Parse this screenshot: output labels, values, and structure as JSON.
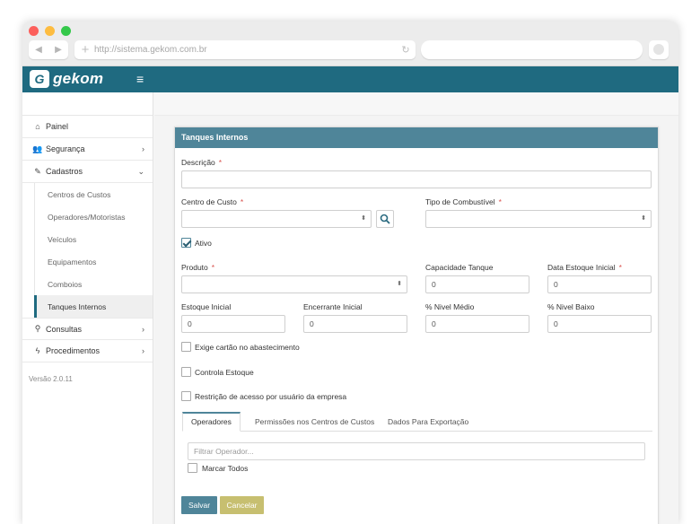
{
  "browser": {
    "url": "http://sistema.gekom.com.br",
    "back_icon": "◀",
    "forward_icon": "▶",
    "plus_icon": "+",
    "reload_icon": "↻"
  },
  "app": {
    "logo_mark": "G",
    "logo_text": "gekom",
    "menu_icon": "≡"
  },
  "sidebar": {
    "items": [
      {
        "label": "Painel",
        "icon": "⌂"
      },
      {
        "label": "Segurança",
        "icon": "👥",
        "chevron": "›"
      },
      {
        "label": "Cadastros",
        "icon": "✎",
        "chevron": "⌄"
      }
    ],
    "sub_items": [
      {
        "label": "Centros de Custos"
      },
      {
        "label": "Operadores/Motoristas"
      },
      {
        "label": "Veículos"
      },
      {
        "label": "Equipamentos"
      },
      {
        "label": "Comboios"
      },
      {
        "label": "Tanques Internos"
      }
    ],
    "items_after": [
      {
        "label": "Consultas",
        "icon": "⚲",
        "chevron": "›"
      },
      {
        "label": "Procedimentos",
        "icon": "ϟ",
        "chevron": "›"
      }
    ],
    "version": "Versão 2.0.11"
  },
  "panel": {
    "title": "Tanques Internos",
    "required_mark": "*",
    "descricao": {
      "label": "Descrição",
      "value": ""
    },
    "centro_custo": {
      "label": "Centro de Custo",
      "value": ""
    },
    "tipo_combustivel": {
      "label": "Tipo de Combustível",
      "value": ""
    },
    "ativo": {
      "label": "Ativo",
      "checked": true
    },
    "produto": {
      "label": "Produto",
      "value": ""
    },
    "capacidade": {
      "label": "Capacidade Tanque",
      "value": "0"
    },
    "data_estoque": {
      "label": "Data Estoque Inicial",
      "value": "0"
    },
    "estoque_inicial": {
      "label": "Estoque Inicial",
      "value": "0"
    },
    "encerrante": {
      "label": "Encerrante Inicial",
      "value": "0"
    },
    "nivel_medio": {
      "label": "% Nivel Médio",
      "value": "0"
    },
    "nivel_baixo": {
      "label": "% Nivel Baixo",
      "value": "0"
    },
    "exige_cartao": {
      "label": "Exige cartão no abastecimento",
      "checked": false
    },
    "controla_estoque": {
      "label": "Controla Estoque",
      "checked": false
    },
    "restricao": {
      "label": "Restrição de acesso por usuário da empresa",
      "checked": false
    },
    "select_arrow": "⬍",
    "tabs": [
      {
        "label": "Operadores",
        "active": true
      },
      {
        "label": "Permissões nos Centros de Custos",
        "active": false
      },
      {
        "label": "Dados Para Exportação",
        "active": false
      }
    ],
    "filter_placeholder": "Filtrar Operador...",
    "marcar_todos": "Marcar Todos",
    "save_label": "Salvar",
    "cancel_label": "Cancelar"
  }
}
